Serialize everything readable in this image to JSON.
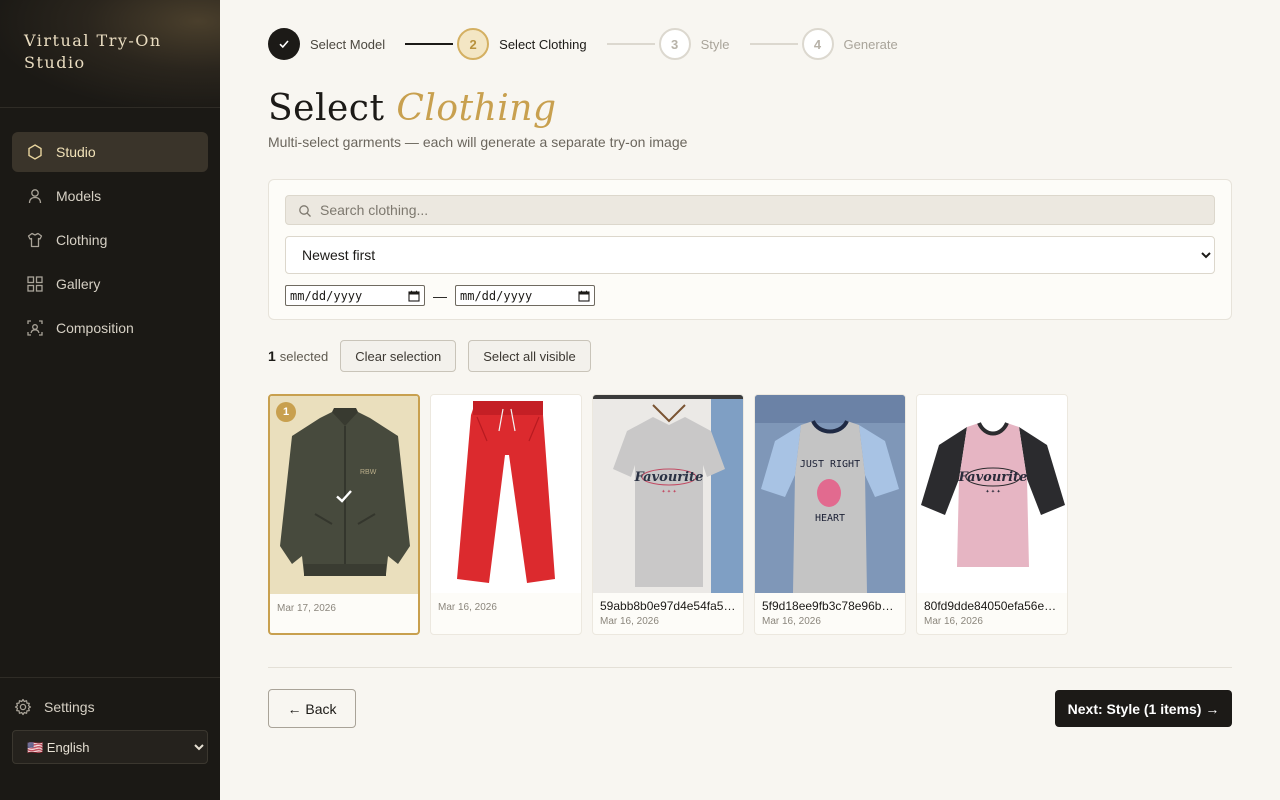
{
  "app": {
    "title": "Virtual Try-On Studio"
  },
  "sidebar": {
    "items": [
      {
        "label": "Studio",
        "icon": "hexagon-icon",
        "active": true
      },
      {
        "label": "Models",
        "icon": "user-icon",
        "active": false
      },
      {
        "label": "Clothing",
        "icon": "shirt-icon",
        "active": false
      },
      {
        "label": "Gallery",
        "icon": "grid-icon",
        "active": false
      },
      {
        "label": "Composition",
        "icon": "composition-icon",
        "active": false
      }
    ],
    "settings_label": "Settings",
    "language": "🇺🇸 English"
  },
  "stepper": {
    "steps": [
      {
        "number": "1",
        "label": "Select Model",
        "state": "done"
      },
      {
        "number": "2",
        "label": "Select Clothing",
        "state": "current"
      },
      {
        "number": "3",
        "label": "Style",
        "state": "todo"
      },
      {
        "number": "4",
        "label": "Generate",
        "state": "todo"
      }
    ]
  },
  "header": {
    "title_plain": "Select",
    "title_accent": "Clothing",
    "subtitle": "Multi-select garments — each will generate a separate try-on image"
  },
  "filters": {
    "search_placeholder": "Search clothing...",
    "sort_selected": "Newest first",
    "date_from_placeholder": "mm/dd/yyyy",
    "date_separator": "—",
    "date_to_placeholder": "mm/dd/yyyy"
  },
  "selection": {
    "count": "1",
    "count_suffix": "selected",
    "clear_label": "Clear selection",
    "select_all_label": "Select all visible"
  },
  "items": [
    {
      "name": "",
      "date": "Mar 17, 2026",
      "selected": true,
      "badge": "1",
      "kind": "jacket"
    },
    {
      "name": "",
      "date": "Mar 16, 2026",
      "selected": false,
      "kind": "pants"
    },
    {
      "name": "59abb8b0e97d4e54fa5…",
      "date": "Mar 16, 2026",
      "selected": false,
      "kind": "tshirt-grey"
    },
    {
      "name": "5f9d18ee9fb3c78e96b0…",
      "date": "Mar 16, 2026",
      "selected": false,
      "kind": "tshirt-raglan-blue"
    },
    {
      "name": "80fd9dde84050efa56e…",
      "date": "Mar 16, 2026",
      "selected": false,
      "kind": "tshirt-raglan-pink"
    }
  ],
  "footer": {
    "back_label": "← Back",
    "next_label": "Next: Style (1 items) →"
  },
  "colors": {
    "accent": "#c8a04f",
    "sidebar_bg": "#1b1915",
    "primary_button": "#1c1a17"
  }
}
